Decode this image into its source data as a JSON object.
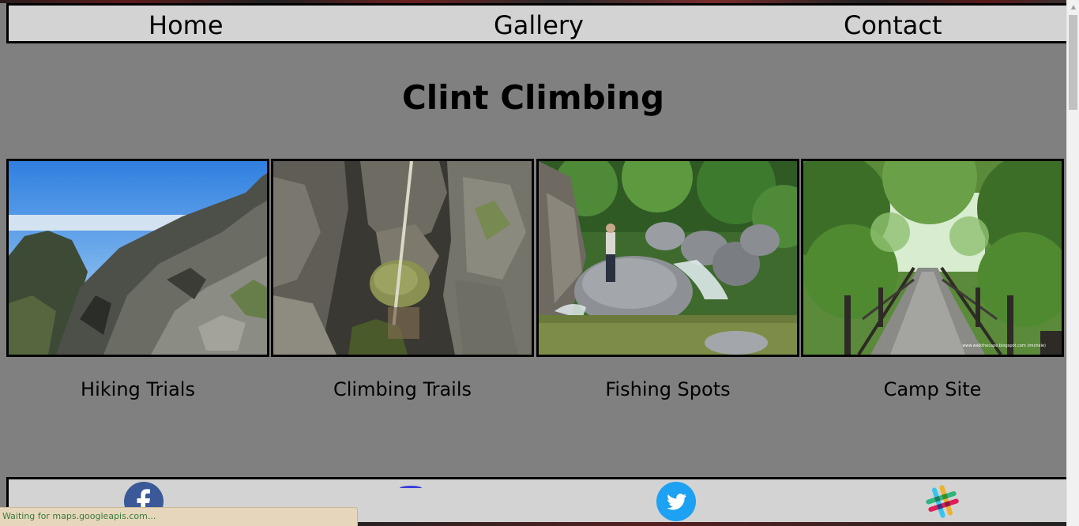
{
  "nav": {
    "items": [
      {
        "label": "Home"
      },
      {
        "label": "Gallery"
      },
      {
        "label": "Contact"
      }
    ]
  },
  "page": {
    "title": "Clint Climbing"
  },
  "gallery": {
    "cards": [
      {
        "label": "Hiking Trials",
        "image": "mountain-cliff-photo"
      },
      {
        "label": "Climbing Trails",
        "image": "rock-gorge-photo"
      },
      {
        "label": "Fishing Spots",
        "image": "river-boulders-photo"
      },
      {
        "label": "Camp Site",
        "image": "forest-boardwalk-photo",
        "watermark": "www.walkthecape.blogspot.com (michele)"
      }
    ]
  },
  "footer": {
    "social": [
      {
        "name": "facebook-icon",
        "color": "#3b5998"
      },
      {
        "name": "maps-icon",
        "color": "#3b3bdb"
      },
      {
        "name": "twitter-icon",
        "color": "#1da1f2"
      },
      {
        "name": "slack-icon",
        "colors": [
          "#36c5f0",
          "#2eb67d",
          "#ecb22e",
          "#e01e5a"
        ]
      }
    ]
  },
  "status": {
    "text": "Waiting for maps.googleapis.com..."
  },
  "colors": {
    "page_background": "#808080",
    "bar_background": "#d3d3d3",
    "status_text": "#3a7a3a"
  }
}
